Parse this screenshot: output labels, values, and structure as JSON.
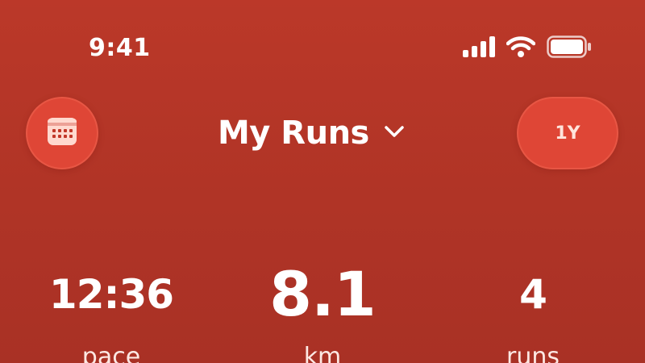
{
  "status_bar": {
    "time": "9:41",
    "icons": [
      "cellular-signal-icon",
      "wifi-icon",
      "battery-icon"
    ]
  },
  "header": {
    "calendar_icon": "calendar-icon",
    "title": "My Runs",
    "dropdown_icon": "chevron-down-icon",
    "range_label": "1Y"
  },
  "stats": {
    "pace": {
      "value": "12:36",
      "label": "pace"
    },
    "distance": {
      "value": "8.1",
      "label": "km"
    },
    "runs": {
      "value": "4",
      "label": "runs"
    }
  },
  "colors": {
    "background": "#b03426",
    "button_fill": "#e14837",
    "text": "#ffffff"
  }
}
